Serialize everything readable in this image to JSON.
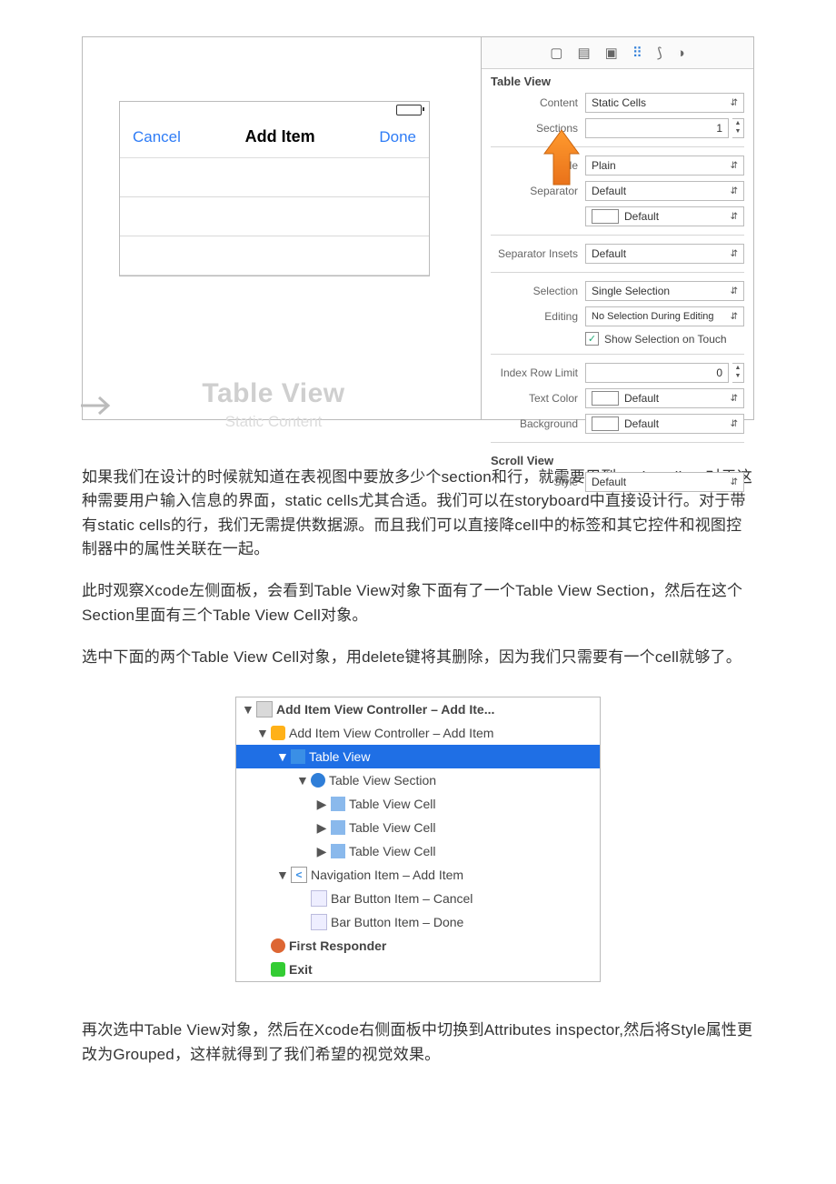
{
  "phone_preview": {
    "cancel": "Cancel",
    "title": "Add Item",
    "done": "Done",
    "placeholder_title": "Table View",
    "placeholder_sub": "Static Content"
  },
  "inspector_tabs": [
    "▢",
    "▤",
    "▣",
    "⠿",
    "⟆",
    "◑"
  ],
  "inspector": {
    "table_view_label": "Table View",
    "content_label": "Content",
    "content_value": "Static Cells",
    "sections_label": "Sections",
    "sections_value": "1",
    "style_label": "Style",
    "style_value": "Plain",
    "separator_label": "Separator",
    "separator_value": "Default",
    "separator_color_value": "Default",
    "separator_insets_label": "Separator Insets",
    "separator_insets_value": "Default",
    "selection_label": "Selection",
    "selection_value": "Single Selection",
    "editing_label": "Editing",
    "editing_value": "No Selection During Editing",
    "show_selection_on_touch": "Show Selection on Touch",
    "index_row_limit_label": "Index Row Limit",
    "index_row_limit_value": "0",
    "text_color_label": "Text Color",
    "text_color_value": "Default",
    "background_label": "Background",
    "background_value": "Default",
    "scroll_view_label": "Scroll View",
    "sv_style_label": "Style",
    "sv_style_value": "Default"
  },
  "paragraphs": {
    "p1": "如果我们在设计的时候就知道在表视图中要放多少个section和行，就需要用到static cells。对于这种需要用户输入信息的界面，static cells尤其合适。我们可以在storyboard中直接设计行。对于带有static cells的行，我们无需提供数据源。而且我们可以直接降cell中的标签和其它控件和视图控制器中的属性关联在一起。",
    "p2": "此时观察Xcode左侧面板，会看到Table View对象下面有了一个Table View Section，然后在这个Section里面有三个Table View Cell对象。",
    "p3": "选中下面的两个Table View Cell对象，用delete键将其删除，因为我们只需要有一个cell就够了。",
    "p4": "再次选中Table View对象，然后在Xcode右侧面板中切换到Attributes inspector,然后将Style属性更改为Grouped，这样就得到了我们希望的视觉效果。"
  },
  "outline": {
    "scene": "Add Item View Controller – Add Ite...",
    "vc": "Add Item View Controller – Add Item",
    "tv": "Table View",
    "section": "Table View Section",
    "cell": "Table View Cell",
    "nav": "Navigation Item – Add Item",
    "bar_cancel": "Bar Button Item – Cancel",
    "bar_done": "Bar Button Item – Done",
    "first_responder": "First Responder",
    "exit": "Exit"
  }
}
